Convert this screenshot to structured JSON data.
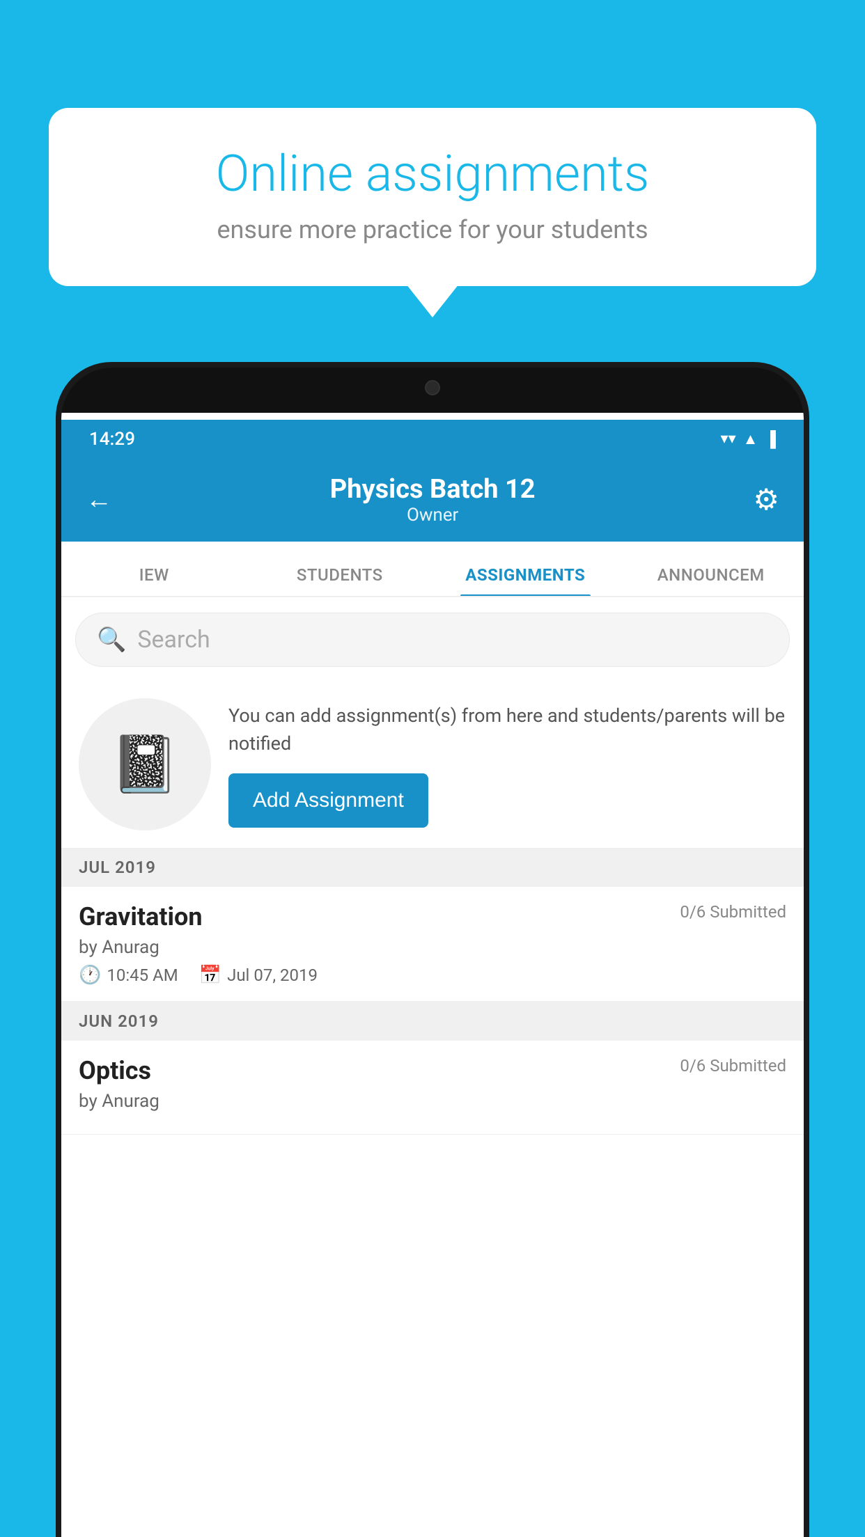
{
  "background_color": "#1AB8E8",
  "speech_bubble": {
    "title": "Online assignments",
    "subtitle": "ensure more practice for your students"
  },
  "status_bar": {
    "time": "14:29",
    "wifi": "▼",
    "signal": "◀",
    "battery": "▌"
  },
  "app_bar": {
    "title": "Physics Batch 12",
    "subtitle": "Owner",
    "back_label": "←",
    "settings_label": "⚙"
  },
  "tabs": [
    {
      "id": "iew",
      "label": "IEW",
      "active": false
    },
    {
      "id": "students",
      "label": "STUDENTS",
      "active": false
    },
    {
      "id": "assignments",
      "label": "ASSIGNMENTS",
      "active": true
    },
    {
      "id": "announcements",
      "label": "ANNOUNCEM...",
      "active": false
    }
  ],
  "search": {
    "placeholder": "Search"
  },
  "promo": {
    "description": "You can add assignment(s) from here and students/parents will be notified",
    "button_label": "Add Assignment"
  },
  "sections": [
    {
      "id": "jul-2019",
      "header": "JUL 2019",
      "assignments": [
        {
          "id": "gravitation",
          "title": "Gravitation",
          "submitted": "0/6 Submitted",
          "author": "by Anurag",
          "time": "10:45 AM",
          "date": "Jul 07, 2019"
        }
      ]
    },
    {
      "id": "jun-2019",
      "header": "JUN 2019",
      "assignments": [
        {
          "id": "optics",
          "title": "Optics",
          "submitted": "0/6 Submitted",
          "author": "by Anurag",
          "time": "",
          "date": ""
        }
      ]
    }
  ]
}
